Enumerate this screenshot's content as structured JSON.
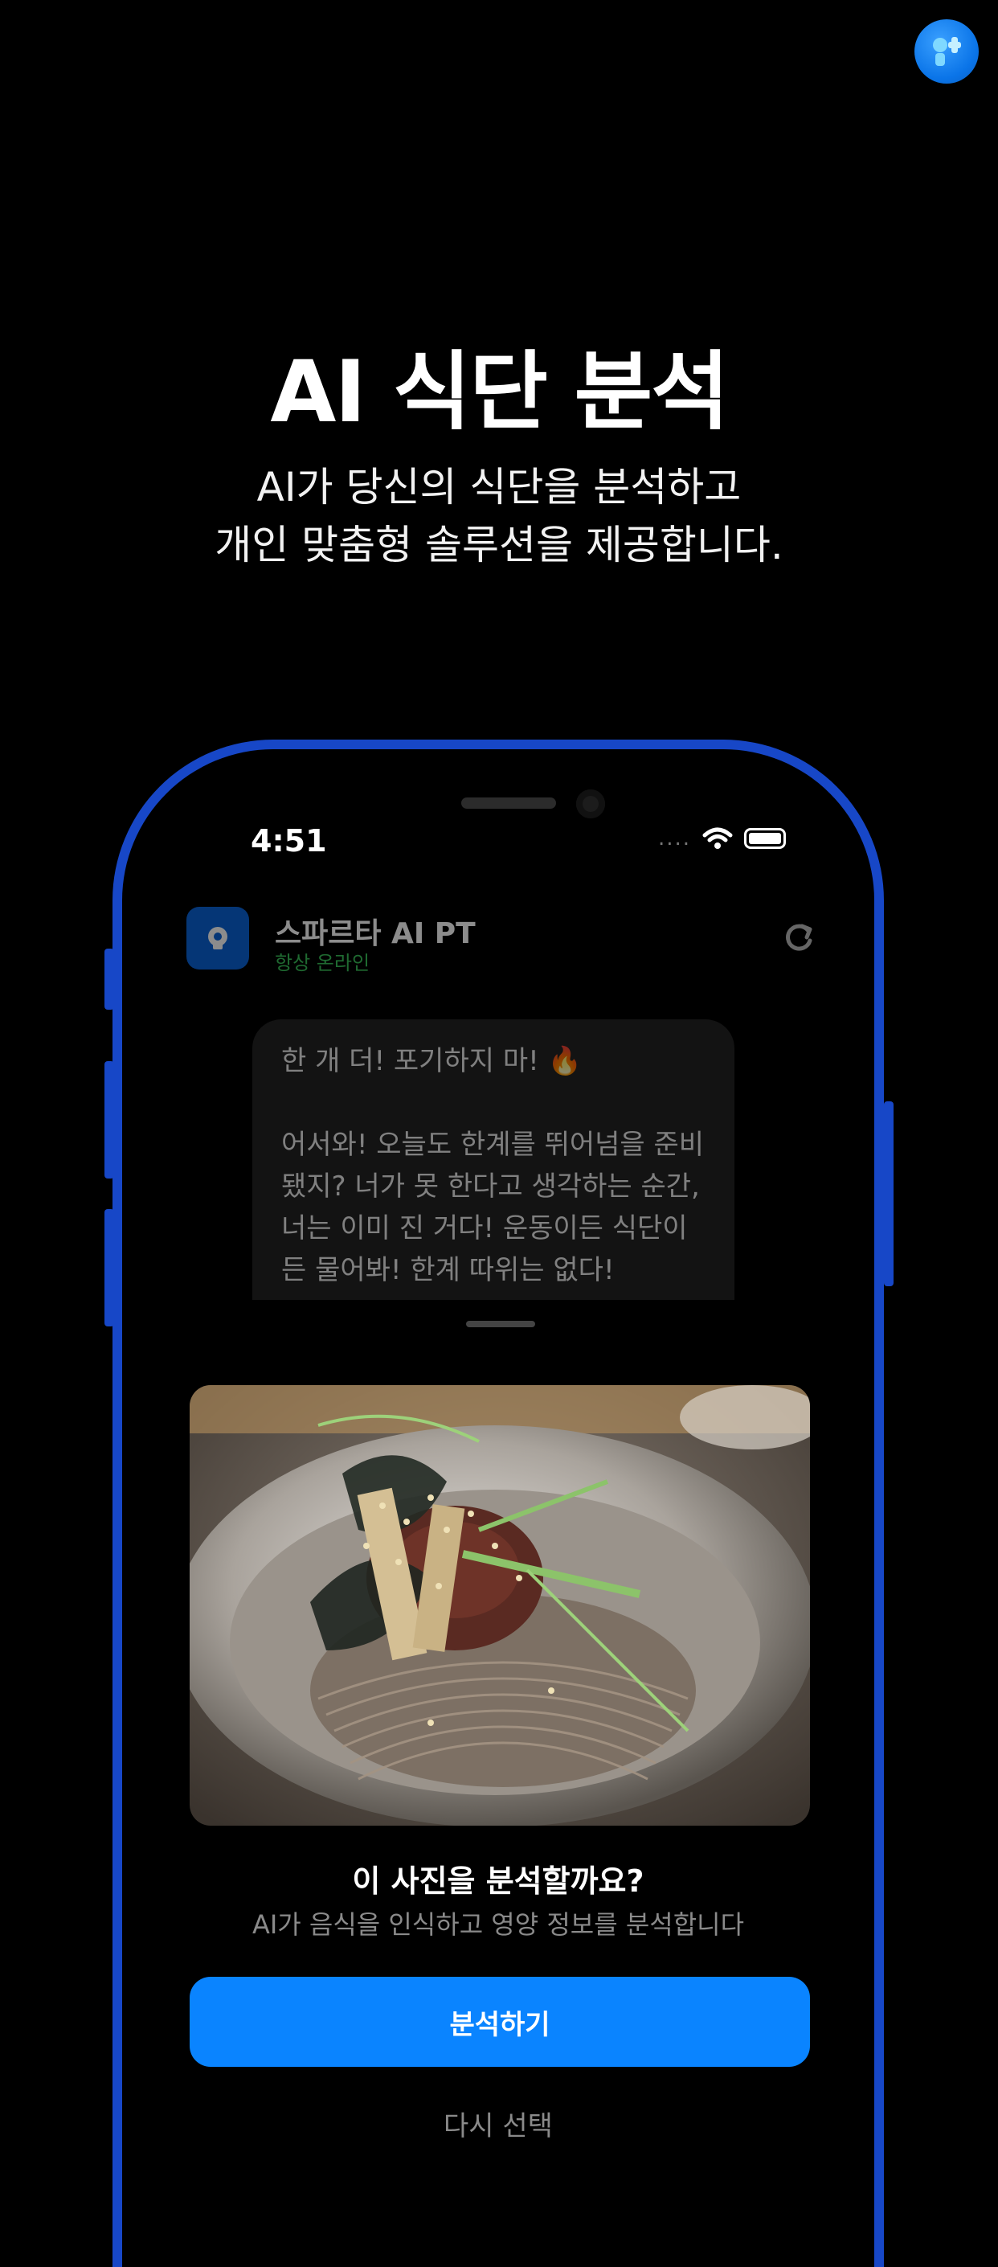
{
  "hero": {
    "title": "AI 식단 분석",
    "subtitle_line1": "AI가 당신의 식단을 분석하고",
    "subtitle_line2": "개인 맞춤형 솔루션을 제공합니다."
  },
  "status_bar": {
    "time": "4:51",
    "signal": "....",
    "wifi_icon": "wifi-icon",
    "battery_icon": "battery-icon"
  },
  "chat": {
    "name": "스파르타 AI PT",
    "status": "항상 온라인",
    "message": {
      "line1": "한 개 더! 포기하지 마! 🔥",
      "line2": "어서와! 오늘도 한계를 뛰어넘을 준비",
      "line3": "됐지? 너가 못 한다고 생각하는 순간,",
      "line4": "너는 이미 진 거다! 운동이든 식단이",
      "line5": "든 물어봐! 한계 따위는 없다!"
    }
  },
  "sheet": {
    "title": "이 사진을 분석할까요?",
    "subtitle": "AI가 음식을 인식하고 영양 정보를 분석합니다",
    "analyze_label": "분석하기",
    "reselect_label": "다시 선택"
  },
  "colors": {
    "accent": "#0a84ff",
    "frame": "#1747c7",
    "online": "#3ac25a"
  }
}
